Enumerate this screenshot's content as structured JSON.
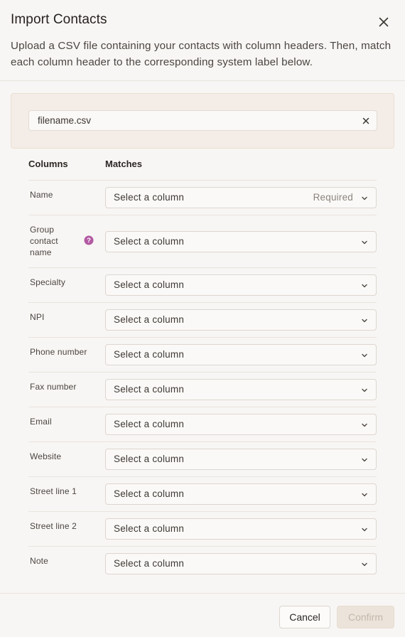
{
  "dialog": {
    "title": "Import Contacts",
    "description": "Upload a CSV file containing your contacts with column headers. Then, match each column header to the corresponding system label below."
  },
  "upload": {
    "file_name": "filename.csv"
  },
  "columns": {
    "left_header": "Columns",
    "right_header": "Matches"
  },
  "rows": [
    {
      "label": "Name",
      "placeholder": "Select a column",
      "required_text": "Required"
    },
    {
      "label": "Group contact name",
      "placeholder": "Select a column"
    },
    {
      "label": "Specialty",
      "placeholder": "Select a column"
    },
    {
      "label": "NPI",
      "placeholder": "Select a column"
    },
    {
      "label": "Phone number",
      "placeholder": "Select a column"
    },
    {
      "label": "Fax number",
      "placeholder": "Select a column"
    },
    {
      "label": "Email",
      "placeholder": "Select a column"
    },
    {
      "label": "Website",
      "placeholder": "Select a column"
    },
    {
      "label": "Street line 1",
      "placeholder": "Select a column"
    },
    {
      "label": "Street line 2",
      "placeholder": "Select a column"
    },
    {
      "label": "Note",
      "placeholder": "Select a column"
    }
  ],
  "footer": {
    "cancel_label": "Cancel",
    "confirm_label": "Confirm"
  },
  "colors": {
    "accent_help": "#b35aa3",
    "upload_bg": "#f4ede7",
    "confirm_disabled": "#ece3da"
  },
  "icons": {
    "close": "close-icon",
    "remove_file": "x-icon",
    "help": "question-circle-icon",
    "dropdown": "chevron-down-icon"
  }
}
